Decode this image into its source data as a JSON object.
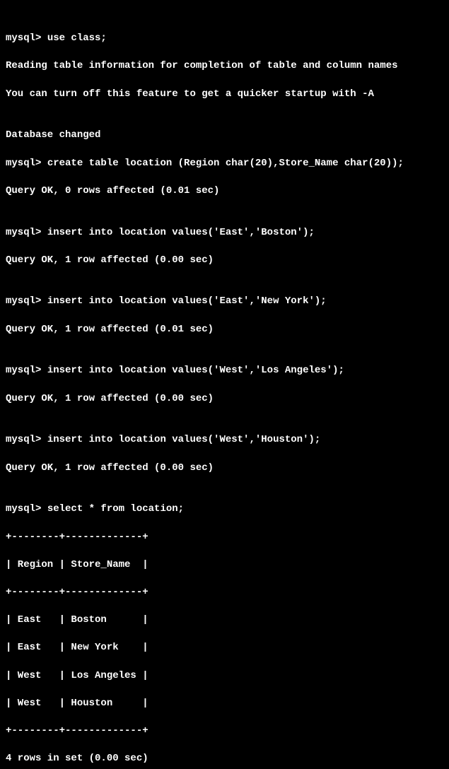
{
  "prompt": "mysql> ",
  "cmd1": "use class;",
  "info1": "Reading table information for completion of table and column names",
  "info2": "You can turn off this feature to get a quicker startup with -A",
  "blank": "",
  "dbchanged": "Database changed",
  "cmd2": "create table location (Region char(20),Store_Name char(20));",
  "resp2": "Query OK, 0 rows affected (0.01 sec)",
  "cmd3": "insert into location values('East','Boston');",
  "resp3": "Query OK, 1 row affected (0.00 sec)",
  "cmd4": "insert into location values('East','New York');",
  "resp4": "Query OK, 1 row affected (0.01 sec)",
  "cmd5": "insert into location values('West','Los Angeles');",
  "resp5": "Query OK, 1 row affected (0.00 sec)",
  "cmd6": "insert into location values('West','Houston');",
  "resp6": "Query OK, 1 row affected (0.00 sec)",
  "cmd7": "select * from location;",
  "tborder": "+--------+-------------+",
  "theader": "| Region | Store_Name  |",
  "trow1": "| East   | Boston      |",
  "trow2": "| East   | New York    |",
  "trow3": "| West   | Los Angeles |",
  "trow4": "| West   | Houston     |",
  "tfooter": "4 rows in set (0.00 sec)",
  "chart_data": {
    "type": "table",
    "title": "location",
    "columns": [
      "Region",
      "Store_Name"
    ],
    "rows": [
      [
        "East",
        "Boston"
      ],
      [
        "East",
        "New York"
      ],
      [
        "West",
        "Los Angeles"
      ],
      [
        "West",
        "Houston"
      ]
    ]
  }
}
